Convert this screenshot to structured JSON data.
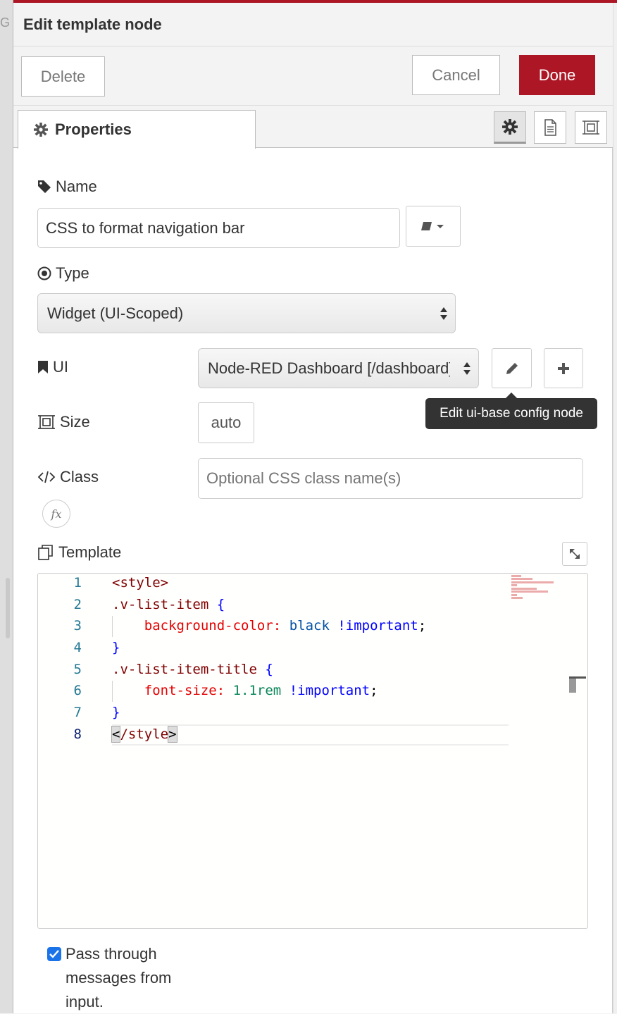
{
  "dialog": {
    "title": "Edit template node",
    "delete_label": "Delete",
    "cancel_label": "Cancel",
    "done_label": "Done"
  },
  "tabs": {
    "properties_label": "Properties"
  },
  "fields": {
    "name_label": "Name",
    "name_value": "CSS to format navigation bar",
    "type_label": "Type",
    "type_value": "Widget (UI-Scoped)",
    "ui_label": "UI",
    "ui_value": "Node-RED Dashboard [/dashboard]",
    "size_label": "Size",
    "size_value": "auto",
    "class_label": "Class",
    "class_placeholder": "Optional CSS class name(s)",
    "template_label": "Template",
    "fx_label": "fx"
  },
  "tooltip": {
    "text": "Edit ui-base config node"
  },
  "editor": {
    "line_numbers": [
      "1",
      "2",
      "3",
      "4",
      "5",
      "6",
      "7",
      "8"
    ],
    "current_line": 8
  },
  "pass_through": {
    "checked": true,
    "label": "Pass through messages from input."
  },
  "colors": {
    "accent": "#ad1625",
    "checkbox": "#1a73e8"
  },
  "icons": {
    "properties_tab": "gear-icon",
    "description_tab": "document-icon",
    "appearance_tab": "layout-icon",
    "name": "tag-icon",
    "type": "radio-dot-icon",
    "ui": "bookmark-icon",
    "size": "resize-icon",
    "class": "code-icon",
    "template": "copy-icon",
    "edit": "pencil-icon",
    "add": "plus-icon",
    "expand": "expand-icon",
    "book": "book-icon"
  },
  "left_gutter_char": "G"
}
